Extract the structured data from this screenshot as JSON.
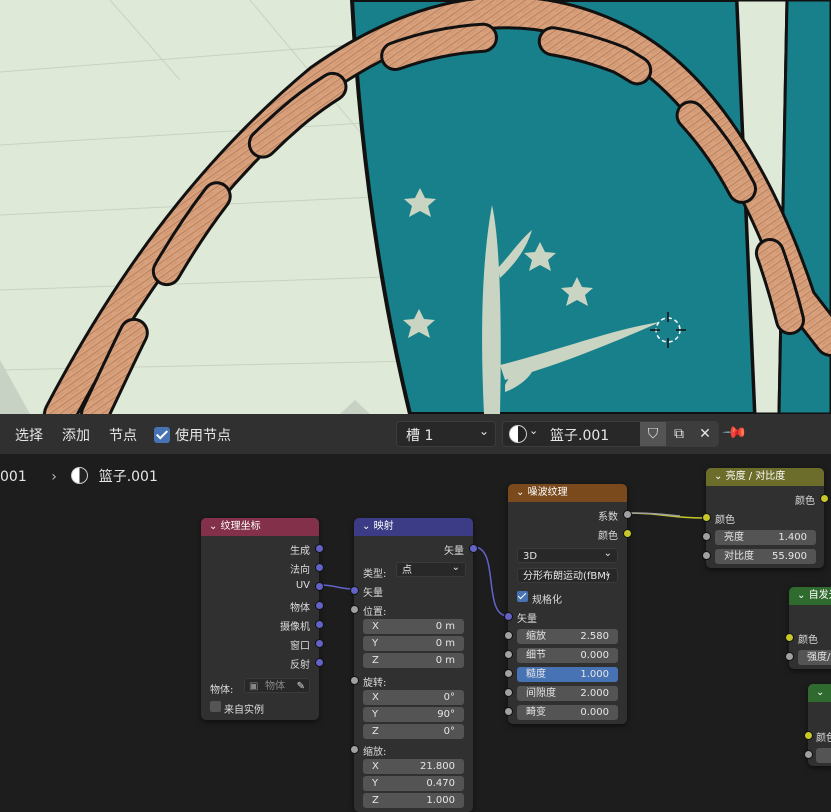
{
  "toolbar": {
    "select": "选择",
    "add": "添加",
    "node": "节点",
    "use_nodes": "使用节点",
    "slot": "槽 1",
    "material_name": "篮子.001"
  },
  "breadcrumb": {
    "parent": "001",
    "material": "篮子.001"
  },
  "nodes": {
    "texcoord": {
      "title": "纹理坐标",
      "outputs": [
        "生成",
        "法向",
        "UV",
        "物体",
        "摄像机",
        "窗口",
        "反射"
      ],
      "object_label": "物体:",
      "object_placeholder": "物体",
      "from_instancer": "来自实例"
    },
    "mapping": {
      "title": "映射",
      "output": "矢量",
      "type_label": "类型:",
      "type_value": "点",
      "vector": "矢量",
      "location": "位置:",
      "loc": [
        [
          "X",
          "0 m"
        ],
        [
          "Y",
          "0 m"
        ],
        [
          "Z",
          "0 m"
        ]
      ],
      "rotation": "旋转:",
      "rot": [
        [
          "X",
          "0°"
        ],
        [
          "Y",
          "90°"
        ],
        [
          "Z",
          "0°"
        ]
      ],
      "scale": "缩放:",
      "scl": [
        [
          "X",
          "21.800"
        ],
        [
          "Y",
          "0.470"
        ],
        [
          "Z",
          "1.000"
        ]
      ]
    },
    "noise": {
      "title": "噪波纹理",
      "out_fac": "系数",
      "out_color": "颜色",
      "dim": "3D",
      "type": "分形布朗运动(fBM)",
      "normalize": "规格化",
      "vector": "矢量",
      "fields": [
        [
          "缩放",
          "2.580"
        ],
        [
          "细节",
          "0.000"
        ],
        [
          "糙度",
          "1.000"
        ],
        [
          "间隙度",
          "2.000"
        ],
        [
          "畸变",
          "0.000"
        ]
      ]
    },
    "brightness": {
      "title": "亮度 / 对比度",
      "out_color": "颜色",
      "in_color": "颜色",
      "fields": [
        [
          "亮度",
          "1.400"
        ],
        [
          "对比度",
          "55.900"
        ]
      ]
    },
    "emission": {
      "title": "自发光",
      "color": "颜色",
      "strength": "强度/"
    },
    "partial": {
      "color": "颜色"
    }
  },
  "colors": {
    "viewport_bg": "#dfe9d8",
    "teal": "#17808a",
    "rope": "#d9a07c",
    "editor_bg": "#1d1d1d",
    "accent": "#4772b3"
  }
}
